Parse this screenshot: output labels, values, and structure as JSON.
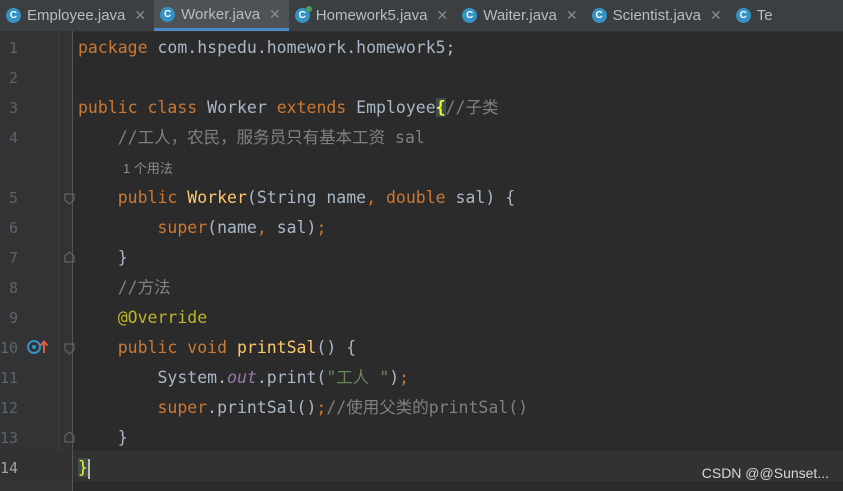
{
  "tabs": [
    {
      "label": "Employee.java",
      "active": false,
      "icon": "class-icon"
    },
    {
      "label": "Worker.java",
      "active": true,
      "icon": "class-icon"
    },
    {
      "label": "Homework5.java",
      "active": false,
      "icon": "class-main-icon"
    },
    {
      "label": "Waiter.java",
      "active": false,
      "icon": "class-icon"
    },
    {
      "label": "Scientist.java",
      "active": false,
      "icon": "class-icon"
    },
    {
      "label": "Te",
      "active": false,
      "icon": "class-icon"
    }
  ],
  "editor": {
    "line_numbers": [
      "1",
      "2",
      "3",
      "4",
      "5",
      "6",
      "7",
      "8",
      "9",
      "10",
      "11",
      "12",
      "13",
      "14"
    ],
    "current_line": "14",
    "usage_hint": "1 个用法",
    "code": {
      "l1_package_kw": "package",
      "l1_package_name": " com.hspedu.homework.homework5;",
      "l3_public": "public",
      "l3_class": "class",
      "l3_name": " Worker ",
      "l3_extends": "extends",
      "l3_parent": " Employee",
      "l3_brace": "{",
      "l3_comment": "//子类",
      "l4_comment": "    //工人，农民，服务员只有基本工资 sal",
      "l5_public": "    public",
      "l5_ctor": " Worker",
      "l5_params_a": "(String name",
      "l5_comma": ", ",
      "l5_double": "double",
      "l5_params_b": " sal) {",
      "l6_super": "        super",
      "l6_args": "(name",
      "l6_comma": ", ",
      "l6_end": "sal)",
      "l6_semi": ";",
      "l7_close": "    }",
      "l8_comment": "    //方法",
      "l9_annotation": "    @Override",
      "l10_public": "    public",
      "l10_void": " void",
      "l10_method": " printSal",
      "l10_rest": "() {",
      "l11_system": "        System.",
      "l11_out": "out",
      "l11_print": ".print(",
      "l11_str": "\"工人 \"",
      "l11_end": ")",
      "l11_semi": ";",
      "l12_super": "        super",
      "l12_call": ".printSal()",
      "l12_semi": ";",
      "l12_comment": "//使用父类的printSal()",
      "l13_close": "    }",
      "l14_brace": "}"
    }
  },
  "watermark": "CSDN @@Sunset..."
}
